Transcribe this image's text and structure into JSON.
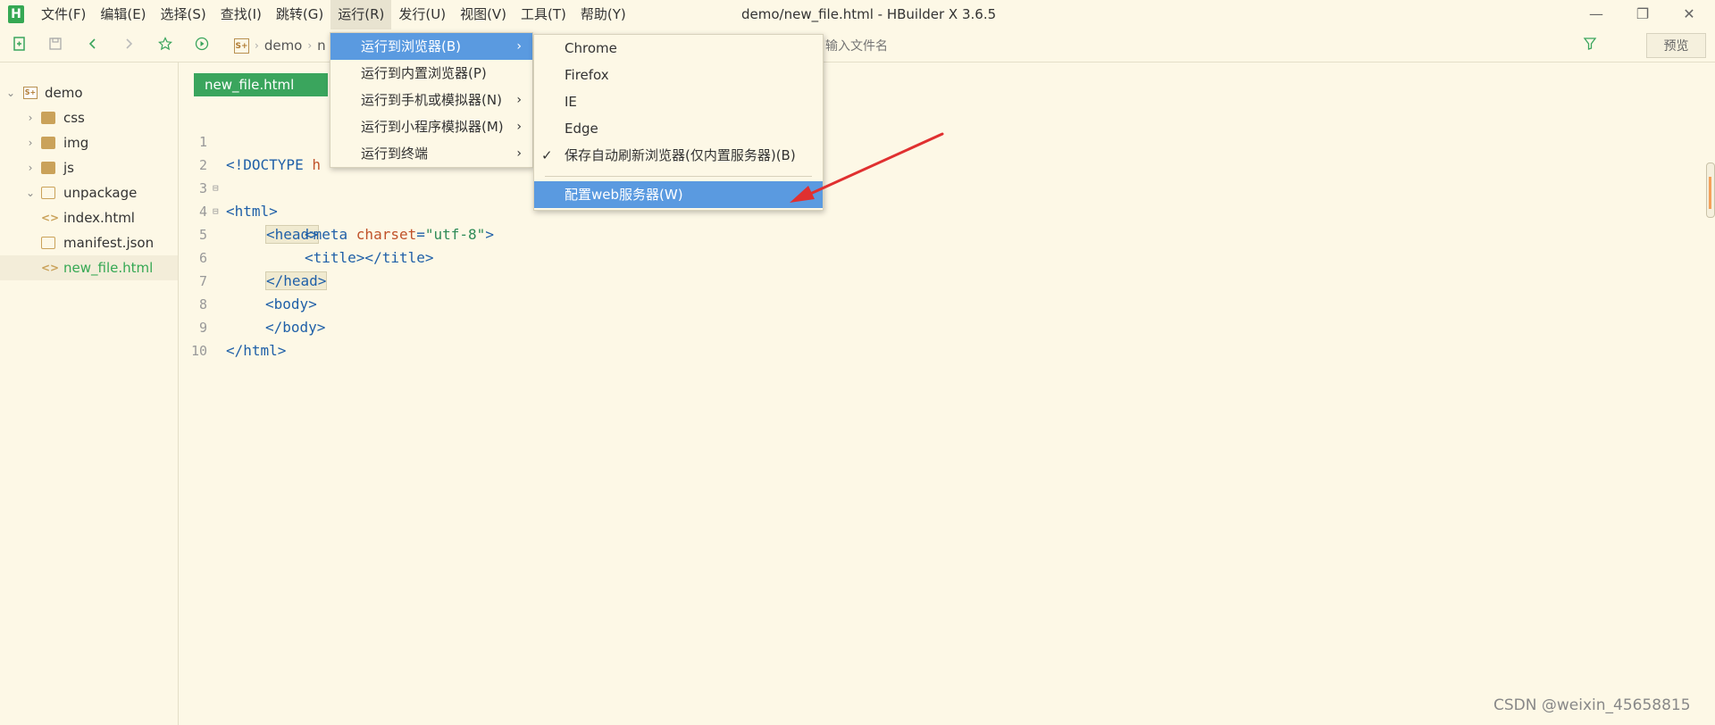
{
  "app": {
    "logo": "H",
    "window_title": "demo/new_file.html - HBuilder X 3.6.5"
  },
  "menubar": {
    "items": [
      "文件(F)",
      "编辑(E)",
      "选择(S)",
      "查找(I)",
      "跳转(G)",
      "运行(R)",
      "发行(U)",
      "视图(V)",
      "工具(T)",
      "帮助(Y)"
    ],
    "active_index": 5
  },
  "window_controls": {
    "minimize": "—",
    "restore": "❐",
    "close": "✕"
  },
  "toolbar": {
    "breadcrumb": [
      "demo",
      "n"
    ],
    "search_placeholder": "输入文件名",
    "preview_label": "预览"
  },
  "sidebar": {
    "project_logo": "S+",
    "items": [
      {
        "label": "demo",
        "type": "project"
      },
      {
        "label": "css",
        "type": "folder"
      },
      {
        "label": "img",
        "type": "folder"
      },
      {
        "label": "js",
        "type": "folder"
      },
      {
        "label": "unpackage",
        "type": "folder-open"
      },
      {
        "label": "index.html",
        "type": "html"
      },
      {
        "label": "manifest.json",
        "type": "json"
      },
      {
        "label": "new_file.html",
        "type": "html",
        "selected": true
      }
    ]
  },
  "editor": {
    "tab_label": "new_file.html",
    "line_numbers": [
      "1",
      "2",
      "3",
      "4",
      "5",
      "6",
      "7",
      "8",
      "9",
      "10"
    ],
    "lines": {
      "l1_tag": "<!DOCTYPE ",
      "l1_rest": "h",
      "l2": "<html>",
      "l3": "<head>",
      "l4_tag": "<meta ",
      "l4_attr": "charset",
      "l4_eq": "=",
      "l4_val": "\"utf-8\"",
      "l4_close": ">",
      "l5": "<title></title>",
      "l6": "</head>",
      "l7": "<body>",
      "l8": "</body>",
      "l9": "</html>"
    },
    "fold_marker": "⊟"
  },
  "run_menu": {
    "items": [
      "运行到浏览器(B)",
      "运行到内置浏览器(P)",
      "运行到手机或模拟器(N)",
      "运行到小程序模拟器(M)",
      "运行到终端"
    ],
    "hover_index": 0
  },
  "browser_submenu": {
    "items": [
      "Chrome",
      "Firefox",
      "IE",
      "Edge"
    ],
    "auto_refresh": "保存自动刷新浏览器(仅内置服务器)(B)",
    "auto_refresh_checked": true,
    "configure_server": "配置web服务器(W)"
  },
  "annotation": {
    "arrow_color": "#e03030"
  },
  "watermark": "CSDN @weixin_45658815"
}
